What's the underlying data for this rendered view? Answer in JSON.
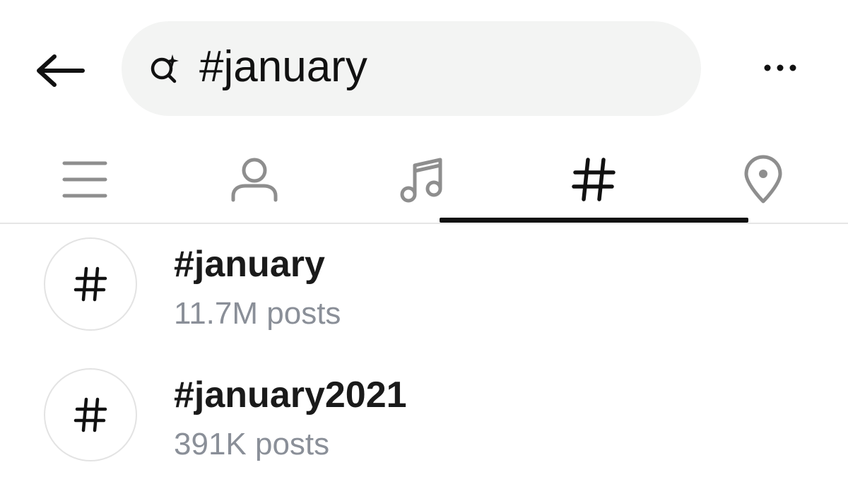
{
  "search": {
    "value": "#january"
  },
  "tabs": [
    {
      "icon": "list-icon",
      "selected": false
    },
    {
      "icon": "user-icon",
      "selected": false
    },
    {
      "icon": "music-note-icon",
      "selected": false
    },
    {
      "icon": "hashtag-icon",
      "selected": true
    },
    {
      "icon": "location-pin-icon",
      "selected": false
    }
  ],
  "results": [
    {
      "icon": "hashtag-icon",
      "title": "#january",
      "subtitle": "11.7M posts"
    },
    {
      "icon": "hashtag-icon",
      "title": "#january2021",
      "subtitle": "391K posts"
    }
  ],
  "colors": {
    "active": "#111111",
    "inactive": "#8e8e8e",
    "search_bg": "#f3f4f3",
    "subtitle": "#8a8f98"
  }
}
